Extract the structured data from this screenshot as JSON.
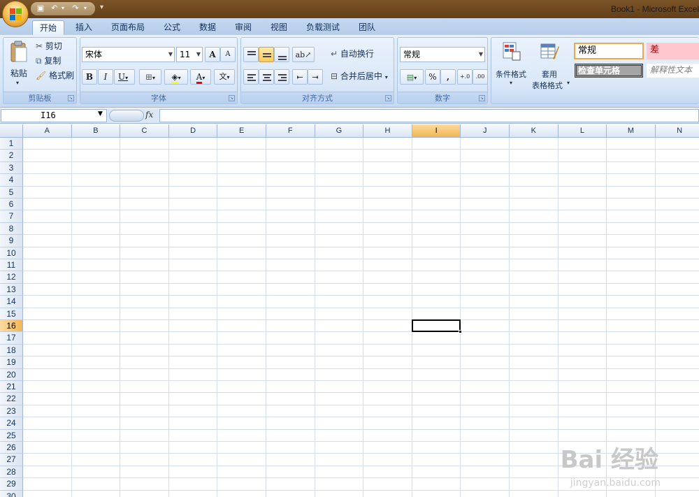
{
  "window": {
    "title": "Book1 - Microsoft Excel"
  },
  "tabs": [
    "开始",
    "插入",
    "页面布局",
    "公式",
    "数据",
    "审阅",
    "视图",
    "负载测试",
    "团队"
  ],
  "clipboard": {
    "paste": "粘贴",
    "cut": "剪切",
    "copy": "复制",
    "format_painter": "格式刷",
    "label": "剪贴板"
  },
  "font": {
    "name": "宋体",
    "size": "11",
    "bold": "B",
    "italic": "I",
    "underline": "U",
    "grow": "A",
    "shrink": "A",
    "phonetic": "文",
    "label": "字体"
  },
  "alignment": {
    "wrap_text": "自动换行",
    "merge_center": "合并后居中",
    "label": "对齐方式"
  },
  "number": {
    "format": "常规",
    "percent": "%",
    "comma": ",",
    "inc_decimal": "+.0",
    "dec_decimal": ".00",
    "label": "数字"
  },
  "styles": {
    "conditional": "条件格式",
    "table_line1": "套用",
    "table_line2": "表格格式",
    "normal": "常规",
    "bad": "差",
    "check_cell": "检查单元格",
    "explanatory": "解释性文本"
  },
  "formula_bar": {
    "name_box": "I16",
    "fx": "fx"
  },
  "grid": {
    "columns": [
      "A",
      "B",
      "C",
      "D",
      "E",
      "F",
      "G",
      "H",
      "I",
      "J",
      "K",
      "L",
      "M",
      "N"
    ],
    "rows": [
      "1",
      "2",
      "3",
      "4",
      "5",
      "6",
      "7",
      "8",
      "9",
      "10",
      "11",
      "12",
      "13",
      "14",
      "15",
      "16",
      "17",
      "18",
      "19",
      "20",
      "21",
      "22",
      "23",
      "24",
      "25",
      "26",
      "27",
      "28",
      "29",
      "30"
    ],
    "selected_column": "I",
    "selected_row": "16"
  },
  "watermark": {
    "main": "Bai 经验",
    "sub": "jingyan.baidu.com"
  },
  "colors": {
    "accent": "#f2b654",
    "grid": "#d5dfec",
    "bad_fill": "#ffc7ce",
    "bad_text": "#9c0006"
  }
}
